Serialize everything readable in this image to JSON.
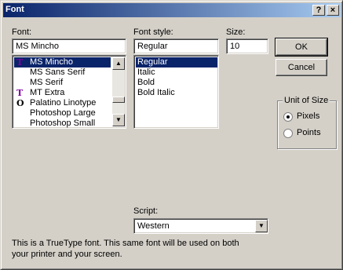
{
  "window": {
    "title": "Font",
    "help_label": "?",
    "close_label": "×"
  },
  "font": {
    "label": "Font:",
    "value": "MS Mincho",
    "items": [
      {
        "name": "MS Mincho",
        "icon": "TT",
        "selected": true
      },
      {
        "name": "MS Sans Serif",
        "icon": "",
        "selected": false
      },
      {
        "name": "MS Serif",
        "icon": "",
        "selected": false
      },
      {
        "name": "MT Extra",
        "icon": "TT",
        "selected": false
      },
      {
        "name": "Palatino Linotype",
        "icon": "O",
        "selected": false
      },
      {
        "name": "Photoshop Large",
        "icon": "",
        "selected": false
      },
      {
        "name": "Photoshop Small",
        "icon": "",
        "selected": false
      }
    ]
  },
  "style": {
    "label": "Font style:",
    "value": "Regular",
    "items": [
      "Regular",
      "Italic",
      "Bold",
      "Bold Italic"
    ]
  },
  "size": {
    "label": "Size:",
    "value": "10"
  },
  "buttons": {
    "ok": "OK",
    "cancel": "Cancel"
  },
  "unit": {
    "label": "Unit of Size",
    "pixels": "Pixels",
    "points": "Points",
    "selected": "Pixels"
  },
  "script": {
    "label": "Script:",
    "value": "Western"
  },
  "description": "This is a TrueType font. This same font will be used on both your printer and your screen.",
  "colors": {
    "face": "#d4d0c8",
    "selection": "#0a246a",
    "tt_icon": "#8000a0"
  }
}
